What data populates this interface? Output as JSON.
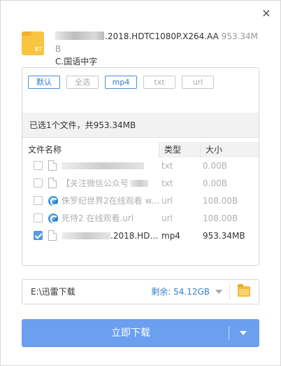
{
  "dialog": {
    "close_icon": "×"
  },
  "torrent": {
    "icon_label": "BT",
    "name_suffix": ".2018.HDTC1080P.X264.AA",
    "size": "953.34MB",
    "name_line2": "C.国语中字"
  },
  "filters": [
    "默认",
    "全选",
    "mp4",
    "txt",
    "url"
  ],
  "filters_active": [
    "默认",
    "mp4"
  ],
  "summary": "已选1个文件，共953.34MB",
  "table": {
    "headers": {
      "name": "文件名称",
      "type": "类型",
      "size": "大小"
    },
    "rows": [
      {
        "name": "",
        "type": "txt",
        "size": "0.00B",
        "checked": false,
        "icon": "doc-icon"
      },
      {
        "name": "【关注微信公众号",
        "type": "txt",
        "size": "0.00B",
        "checked": false,
        "icon": "doc-icon"
      },
      {
        "name": "侏罗纪世界2在线观看 w...",
        "type": "url",
        "size": "108.00B",
        "checked": false,
        "icon": "web-link-icon"
      },
      {
        "name": "死侍2 在线观看.url",
        "type": "url",
        "size": "108.00B",
        "checked": false,
        "icon": "web-link-icon"
      },
      {
        "name": ".2018.HDT...",
        "type": "mp4",
        "size": "953.34MB",
        "checked": true,
        "icon": "doc-icon"
      }
    ]
  },
  "path": {
    "value": "E:\\迅雷下载",
    "free": "剩余: 54.12GB"
  },
  "download": {
    "label": "立即下载"
  }
}
